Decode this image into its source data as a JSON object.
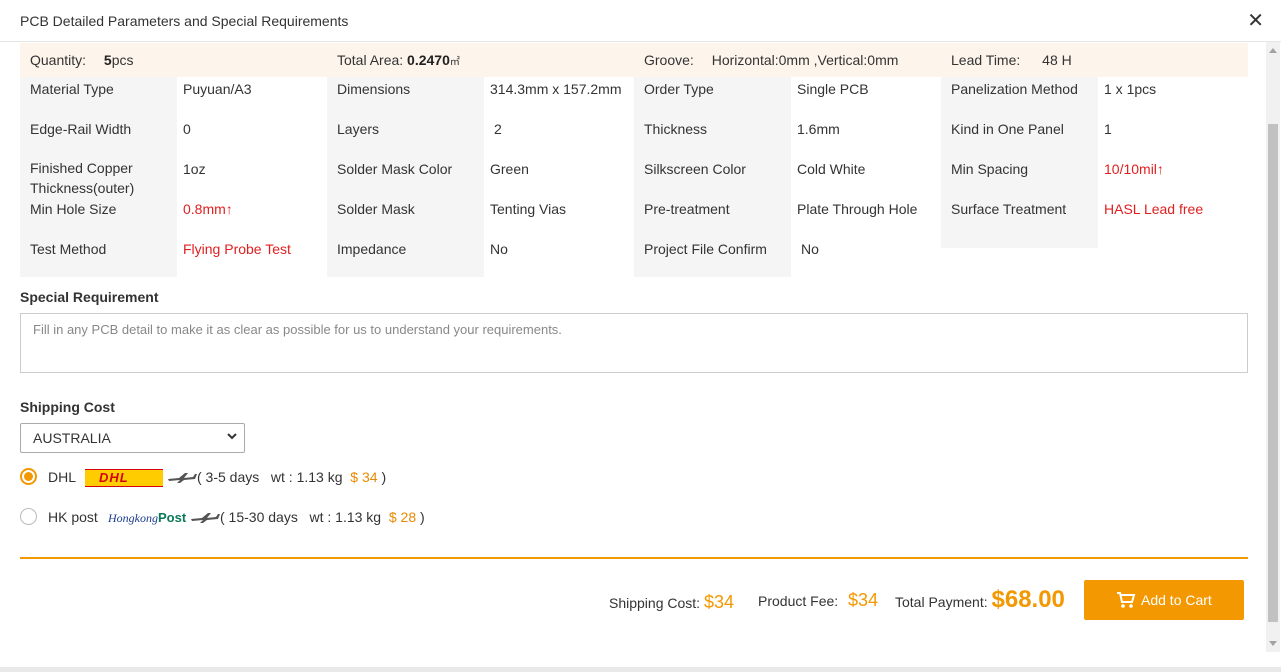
{
  "dialog": {
    "title": "PCB Detailed Parameters and Special Requirements",
    "close_icon": "close-icon"
  },
  "summary": {
    "quantity_label": "Quantity:",
    "quantity_value": "5",
    "quantity_unit": "pcs",
    "area_label": "Total Area:",
    "area_value": "0.2470",
    "area_unit": "㎡",
    "groove_label": "Groove:",
    "groove_value": "Horizontal:0mm ,Vertical:0mm",
    "lead_label": "Lead Time:",
    "lead_value": "48",
    "lead_unit": "H"
  },
  "params": [
    [
      {
        "label": "Material Type",
        "value": "Puyuan/A3"
      },
      {
        "label": "Dimensions",
        "value": "314.3mm x 157.2mm"
      },
      {
        "label": "Order Type",
        "value": "Single PCB"
      },
      {
        "label": "Panelization Method",
        "value": "1 x 1pcs"
      }
    ],
    [
      {
        "label": "Edge-Rail Width",
        "value": "0"
      },
      {
        "label": "Layers",
        "value": "2"
      },
      {
        "label": "Thickness",
        "value": "1.6mm"
      },
      {
        "label": "Kind in One Panel",
        "value": "1"
      }
    ],
    [
      {
        "label": "Finished Copper",
        "label2": "Thickness(outer)",
        "value": "1oz"
      },
      {
        "label": "Solder Mask Color",
        "value": "Green"
      },
      {
        "label": "Silkscreen Color",
        "value": "Cold White"
      },
      {
        "label": "Min Spacing",
        "value": "10/10mil↑",
        "highlight": true
      }
    ],
    [
      {
        "label": "Min Hole Size",
        "value": "0.8mm↑",
        "highlight": true
      },
      {
        "label": "Solder Mask",
        "value": "Tenting Vias"
      },
      {
        "label": "Pre-treatment",
        "value": "Plate Through Hole"
      },
      {
        "label": "Surface Treatment",
        "value": "HASL Lead free",
        "highlight": true
      }
    ],
    [
      {
        "label": "Test Method",
        "value": "Flying Probe Test",
        "highlight": true
      },
      {
        "label": "Impedance",
        "value": "No"
      },
      {
        "label": "Project File Confirm",
        "value": "No"
      }
    ]
  ],
  "special": {
    "title": "Special Requirement",
    "placeholder": "Fill in any PCB detail to make it as clear as possible for us to understand your requirements."
  },
  "shipping": {
    "title": "Shipping Cost",
    "country": "AUSTRALIA",
    "options": [
      {
        "name": "DHL",
        "logo_text": "DHL",
        "selected": true,
        "days": "( 3-5 days",
        "weight": "wt : 1.13 kg",
        "price": "$ 34",
        "close": ")"
      },
      {
        "name": "HK post",
        "logo_text_a": "Hongkong",
        "logo_text_b": "Post",
        "selected": false,
        "days": "( 15-30 days",
        "weight": "wt : 1.13 kg",
        "price": "$ 28",
        "close": ")"
      }
    ]
  },
  "footer": {
    "shipping_label": "Shipping Cost:",
    "shipping_value": "$34",
    "product_label": "Product Fee:",
    "product_value": "$34",
    "total_label": "Total Payment:",
    "total_value": "$68.00",
    "cart_label": "Add to Cart"
  },
  "colors": {
    "accent": "#f39800",
    "highlight_red": "#e02020",
    "summary_bg": "#fdf5ec",
    "label_bg": "#f5f5f5"
  }
}
